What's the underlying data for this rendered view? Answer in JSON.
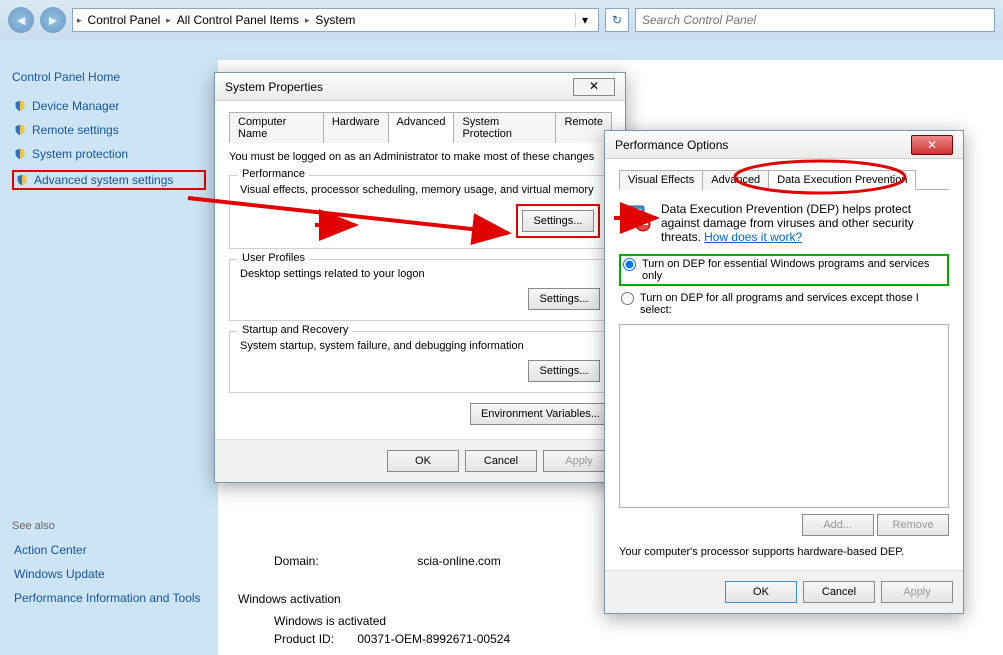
{
  "breadcrumb": [
    "Control Panel",
    "All Control Panel Items",
    "System"
  ],
  "search_placeholder": "Search Control Panel",
  "left_nav": {
    "home": "Control Panel Home",
    "items": [
      "Device Manager",
      "Remote settings",
      "System protection",
      "Advanced system settings"
    ],
    "see_also_label": "See also",
    "see_also": [
      "Action Center",
      "Windows Update",
      "Performance Information and Tools"
    ]
  },
  "content": {
    "domain_label": "Domain:",
    "domain_value": "scia-online.com",
    "activation_heading": "Windows activation",
    "activation_status": "Windows is activated",
    "product_label": "Product ID:",
    "product_value": "00371-OEM-8992671-00524"
  },
  "sys_props": {
    "title": "System Properties",
    "tabs": [
      "Computer Name",
      "Hardware",
      "Advanced",
      "System Protection",
      "Remote"
    ],
    "active_tab": 2,
    "notice": "You must be logged on as an Administrator to make most of these changes",
    "groups": {
      "perf": {
        "title": "Performance",
        "desc": "Visual effects, processor scheduling, memory usage, and virtual memory",
        "btn": "Settings..."
      },
      "user": {
        "title": "User Profiles",
        "desc": "Desktop settings related to your logon",
        "btn": "Settings..."
      },
      "startup": {
        "title": "Startup and Recovery",
        "desc": "System startup, system failure, and debugging information",
        "btn": "Settings..."
      }
    },
    "env_btn": "Environment Variables...",
    "ok": "OK",
    "cancel": "Cancel",
    "apply": "Apply"
  },
  "perf_opts": {
    "title": "Performance Options",
    "tabs": [
      "Visual Effects",
      "Advanced",
      "Data Execution Prevention"
    ],
    "active_tab": 2,
    "dep_desc": "Data Execution Prevention (DEP) helps protect against damage from viruses and other security threats.",
    "dep_link": "How does it work?",
    "radio1": "Turn on DEP for essential Windows programs and services only",
    "radio2": "Turn on DEP for all programs and services except those I select:",
    "add": "Add...",
    "remove": "Remove",
    "footer": "Your computer's processor supports hardware-based DEP.",
    "ok": "OK",
    "cancel": "Cancel",
    "apply": "Apply"
  }
}
